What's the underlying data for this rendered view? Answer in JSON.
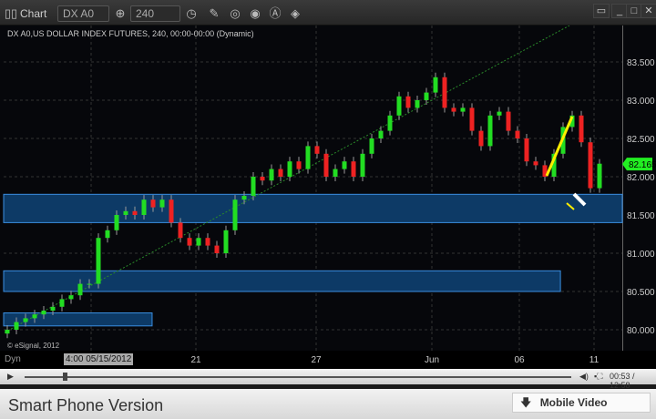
{
  "titlebar": {
    "title": "Chart",
    "symbol": "DX A0",
    "interval": "240"
  },
  "chart_header": "DX A0,US DOLLAR INDEX FUTURES, 240, 00:00-00:00 (Dynamic)",
  "copyright": "© eSignal, 2012",
  "axis": {
    "dyn": "Dyn",
    "cursor_date": "4:00 05/15/2012",
    "x_labels": [
      "21",
      "27",
      "Jun",
      "06",
      "11"
    ]
  },
  "player": {
    "time": "00:53 / 12:58",
    "progress": 0.07
  },
  "footer": {
    "title": "Smart Phone Version",
    "mobile_button": "Mobile Video"
  },
  "colors": {
    "up": "#22dd22",
    "down": "#ee2222",
    "zone": "#0d3a66",
    "zone_border": "#3a8ee0",
    "trend": "#2a8a2a",
    "drawing": "#ffee00",
    "last_price": "#22ee22"
  },
  "chart_data": {
    "type": "candlestick",
    "y_ticks": [
      "80.000",
      "80.500",
      "81.000",
      "81.500",
      "82.000",
      "82.500",
      "83.000",
      "83.500"
    ],
    "ylim": [
      79.9,
      84.0
    ],
    "last_price": "82.165",
    "closes": [
      80.0,
      80.1,
      80.15,
      80.2,
      80.25,
      80.3,
      80.4,
      80.45,
      80.6,
      80.6,
      81.2,
      81.3,
      81.5,
      81.55,
      81.5,
      81.7,
      81.6,
      81.7,
      81.4,
      81.2,
      81.1,
      81.2,
      81.1,
      81.0,
      81.3,
      81.7,
      81.75,
      82.0,
      81.95,
      82.1,
      82.0,
      82.2,
      82.1,
      82.4,
      82.3,
      82.0,
      82.1,
      82.2,
      82.0,
      82.3,
      82.5,
      82.6,
      82.8,
      83.05,
      82.9,
      83.0,
      83.1,
      83.3,
      82.9,
      82.85,
      82.9,
      82.6,
      82.4,
      82.8,
      82.85,
      82.6,
      82.5,
      82.2,
      82.15,
      82.0,
      82.3,
      82.65,
      82.8,
      82.45,
      81.85,
      82.17
    ],
    "zones": [
      [
        81.4,
        81.77,
        0,
        1
      ],
      [
        80.5,
        80.77,
        0,
        0.9
      ],
      [
        80.05,
        80.22,
        0,
        0.24
      ]
    ]
  }
}
